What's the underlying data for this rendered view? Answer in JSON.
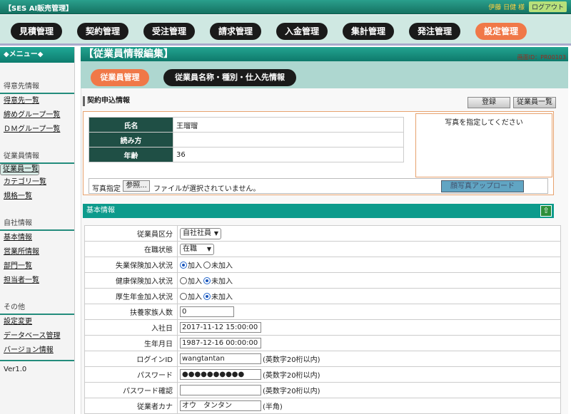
{
  "app": {
    "title": "【SES AI販売管理】",
    "user": "伊藤 日健 様",
    "logout": "ログアウト"
  },
  "nav": [
    {
      "label": "見積管理",
      "active": false
    },
    {
      "label": "契約管理",
      "active": false
    },
    {
      "label": "受注管理",
      "active": false
    },
    {
      "label": "請求管理",
      "active": false
    },
    {
      "label": "入金管理",
      "active": false
    },
    {
      "label": "集計管理",
      "active": false
    },
    {
      "label": "発注管理",
      "active": false
    },
    {
      "label": "設定管理",
      "active": true
    }
  ],
  "sidebar": {
    "menu_title": "◆メニュー◆",
    "sections": [
      {
        "title": "得意先情報",
        "items": [
          {
            "label": "得意先一覧"
          },
          {
            "label": "締めグループ一覧"
          },
          {
            "label": "ＤＭグループ一覧"
          }
        ]
      },
      {
        "title": "従業員情報",
        "items": [
          {
            "label": "従業員一覧",
            "selected": true
          },
          {
            "label": "カテゴリ一覧"
          },
          {
            "label": "規格一覧"
          }
        ]
      },
      {
        "title": "自社情報",
        "items": [
          {
            "label": "基本情報"
          },
          {
            "label": "営業所情報"
          },
          {
            "label": "部門一覧"
          },
          {
            "label": "担当者一覧"
          }
        ]
      },
      {
        "title": "その他",
        "items": [
          {
            "label": "設定変更"
          },
          {
            "label": "データベース管理"
          },
          {
            "label": "バージョン情報"
          }
        ]
      }
    ],
    "version": "Ver1.0"
  },
  "page": {
    "title": "【従業員情報編集】",
    "screen_id": "画面ID：PR00103",
    "subnav": [
      {
        "label": "従業員管理",
        "active": true
      },
      {
        "label": "従業員名称・種別・仕入先情報",
        "active": false
      }
    ],
    "section_title": "契約申込情報",
    "register_button": "登録",
    "list_button": "従業員一覧",
    "info": [
      {
        "label": "氏名",
        "value": "王瑠瑠"
      },
      {
        "label": "読み方",
        "value": ""
      },
      {
        "label": "年齢",
        "value": "36"
      }
    ],
    "photo_placeholder": "写真を指定してください",
    "upload": {
      "label": "写真指定",
      "browse": "参照...",
      "status": "ファイルが選択されていません。",
      "button": "顔写真アップロード"
    },
    "basic_title": "基本情報",
    "collapse_icon": "arrow-up-icon"
  },
  "form": {
    "employee_type": {
      "label": "従業員区分",
      "value": "自社社員"
    },
    "status": {
      "label": "在職状態",
      "value": "在職"
    },
    "unemployment": {
      "label": "失業保険加入状況",
      "options": [
        "加入",
        "未加入"
      ],
      "selected": 0
    },
    "health": {
      "label": "健康保険加入状況",
      "options": [
        "加入",
        "未加入"
      ],
      "selected": 1
    },
    "pension": {
      "label": "厚生年金加入状況",
      "options": [
        "加入",
        "未加入"
      ],
      "selected": 1
    },
    "dependents": {
      "label": "扶養家族人数",
      "value": "0"
    },
    "join_date": {
      "label": "入社日",
      "value": "2017-11-12 15:00:00"
    },
    "birthday": {
      "label": "生年月日",
      "value": "1987-12-16 00:00:00"
    },
    "login_id": {
      "label": "ログインID",
      "value": "wangtantan",
      "hint": "(英数字20桁以内)"
    },
    "password": {
      "label": "パスワード",
      "value": "●●●●●●●●●●",
      "hint": "(英数字20桁以内)"
    },
    "password_confirm": {
      "label": "パスワード確認",
      "value": "",
      "hint": "(英数字20桁以内)"
    },
    "kana": {
      "label": "従業者カナ",
      "value": "オウ　タンタン",
      "hint": "(半角)"
    }
  }
}
